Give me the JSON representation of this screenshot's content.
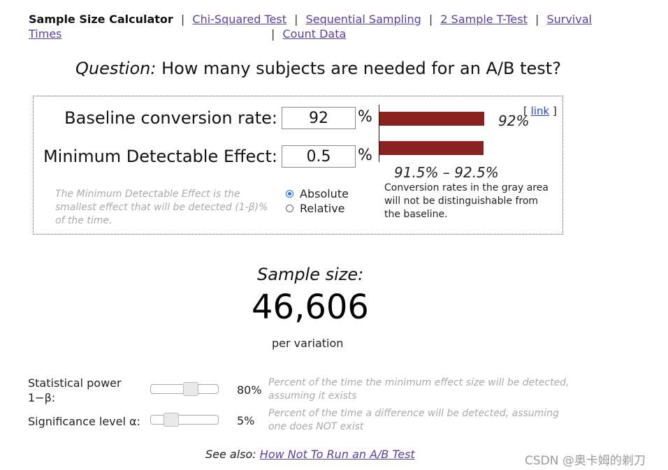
{
  "nav": {
    "current": "Sample Size Calculator",
    "links": [
      "Chi-Squared Test",
      "Sequential Sampling",
      "2 Sample T-Test",
      "Survival Times",
      "Count Data"
    ],
    "separator": "|"
  },
  "question": {
    "prefix": "Question:",
    "text": " How many subjects are needed for an A/B test?"
  },
  "form": {
    "baseline_label": "Baseline conversion rate:",
    "baseline_value": "92",
    "mde_label": "Minimum Detectable Effect:",
    "mde_value": "0.5",
    "percent": "%",
    "mde_hint": "The Minimum Detectable Effect is the smallest effect that will be detected (1-β)% of the time.",
    "mode_options": [
      "Absolute",
      "Relative"
    ],
    "mode_selected": "Absolute"
  },
  "viz": {
    "baseline_pct": "92%",
    "range_label": "91.5% – 92.5%",
    "explanation": "Conversion rates in the gray area will not be distinguishable from the baseline.",
    "link_open": "[",
    "link_text": "link",
    "link_close": "]",
    "bar_color": "#8b2222"
  },
  "result": {
    "title": "Sample size:",
    "value": "46,606",
    "unit": "per variation"
  },
  "sliders": {
    "power": {
      "label_line1": "Statistical power",
      "label_line2": "1−β:",
      "value": "80%",
      "level": 0.8,
      "desc": "Percent of the time the minimum effect size will be detected, assuming it exists"
    },
    "significance": {
      "label": "Significance level α:",
      "value": "5%",
      "level": 0.05,
      "desc": "Percent of the time a difference will be detected, assuming one does NOT exist"
    }
  },
  "see_also": {
    "prefix": "See also: ",
    "link": "How Not To Run an A/B Test"
  },
  "watermark": "CSDN @奥卡姆的剃刀"
}
